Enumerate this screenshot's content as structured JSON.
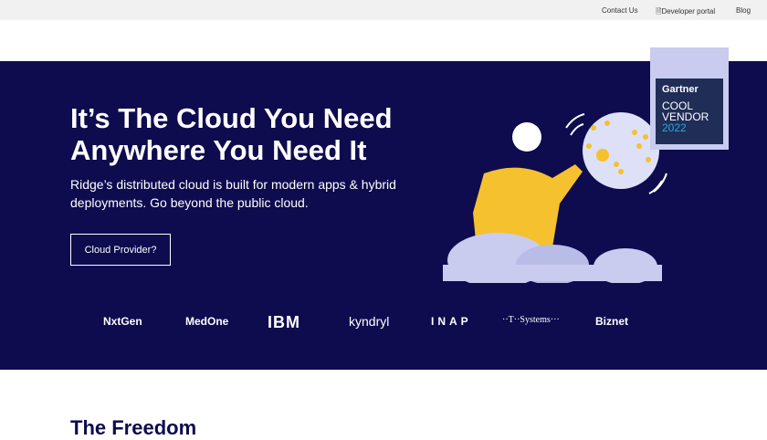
{
  "topbar": {
    "contact": "Contact Us",
    "developer": "Developer portal",
    "blog": "Blog"
  },
  "hero": {
    "title": "It’s The Cloud You Need Anywhere You Need It",
    "subtitle": "Ridge’s distributed cloud is built for modern apps & hybrid deployments. Go beyond the public cloud.",
    "cta": "Cloud Provider?"
  },
  "badge": {
    "brand": "Gartner",
    "line1": "COOL",
    "line2": "VENDOR",
    "year": "2022"
  },
  "partners": [
    "NxtGen",
    "MedOne",
    "IBM",
    "kyndryl",
    "INAP",
    "··T··Systems···",
    "Biznet"
  ],
  "section": {
    "title": "The Freedom"
  },
  "colors": {
    "hero_bg": "#0e0b4f",
    "accent": "#f5c12e"
  }
}
